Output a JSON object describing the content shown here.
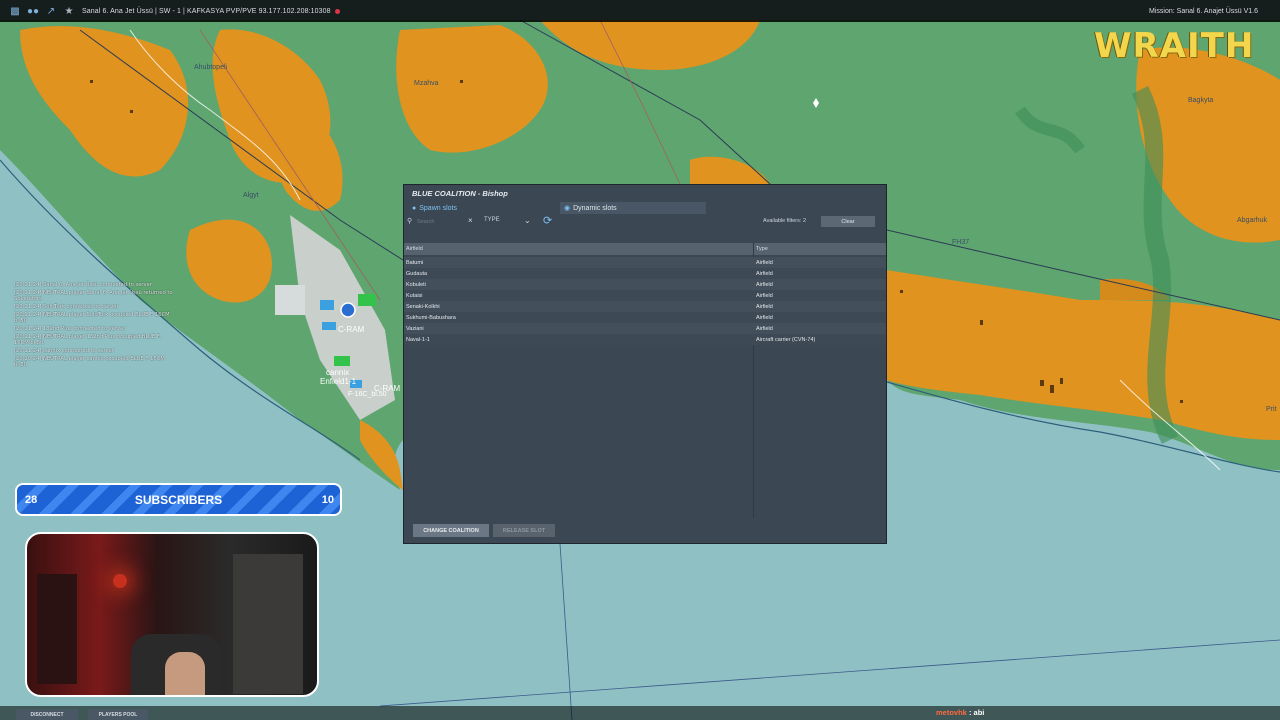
{
  "topbar": {
    "server": "Sanal 6. Ana Jet Üssü | SW - 1 | KAFKASYA PVP/PVE   93.177.102.208:10308",
    "mission": "Mission: Sanal 6. Anajet Üssü V1.6"
  },
  "logo": {
    "text": "WRAITH"
  },
  "map": {
    "labels": [
      "Ahubtopeli",
      "Mzahva",
      "Algyt",
      "FH37",
      "Bagkyta",
      "Abgarhuk",
      "Prit",
      "C-RAM",
      "cannix",
      "Enfield1-1",
      "C-RAM",
      "F-16C_bl.50"
    ]
  },
  "chat": {
    "messages": [
      "[20:11:24] Sanal 6. Ana Jet Üssü connected to server",
      "[20:11:24] NEUTRAL player Sanal 6. Ana Jet Üssü returned to Spectators",
      "[20:11:24] SoloTurk connected to server",
      "[20:11:24] NEUTRAL player SoloTurk occupied BLUE F-16CM bl.50",
      "[20:11:24] 132nd Plus connected to server",
      "[20:11:24] NEUTRAL player 132nd Plus occupied BLUE F-16CM bl.50",
      "[20:11:24] cannix connected to server",
      "[20:10:24] NEUTRAL player cannix occupied BLUE F-16CM bl.50"
    ]
  },
  "subscribers": {
    "current": "28",
    "label": "SUBSCRIBERS",
    "goal": "10"
  },
  "dialog": {
    "title": "BLUE COALITION - Bishop",
    "tabs": {
      "spawn": "Spawn slots",
      "dynamic": "Dynamic slots"
    },
    "search_placeholder": "Search",
    "type_label": "TYPE",
    "available_filters": "Available filters: 2",
    "clear_label": "Clear",
    "columns": {
      "airfield": "Airfield",
      "type": "Type"
    },
    "rows": [
      {
        "name": "Batumi",
        "type": "Airfield"
      },
      {
        "name": "Gudauta",
        "type": "Airfield"
      },
      {
        "name": "Kobuleti",
        "type": "Airfield"
      },
      {
        "name": "Kutaisi",
        "type": "Airfield"
      },
      {
        "name": "Senaki-Kolkhi",
        "type": "Airfield"
      },
      {
        "name": "Sukhumi-Babushara",
        "type": "Airfield"
      },
      {
        "name": "Vaziani",
        "type": "Airfield"
      },
      {
        "name": "Naval-1-1",
        "type": "Aircraft carrier (CVN-74)"
      }
    ],
    "change_coalition": "CHANGE COALITION",
    "release_slot": "RELEASE SLOT"
  },
  "bottombar": {
    "disconnect": "DISCONNECT",
    "players_pool": "PLAYERS POOL"
  },
  "twitch_chat": {
    "user": "metovhk",
    "message": ": abi"
  },
  "colors": {
    "land": "#5fa56f",
    "urban": "#e0931e",
    "sea": "#8fc1c4",
    "accent": "#7ec1f0"
  }
}
